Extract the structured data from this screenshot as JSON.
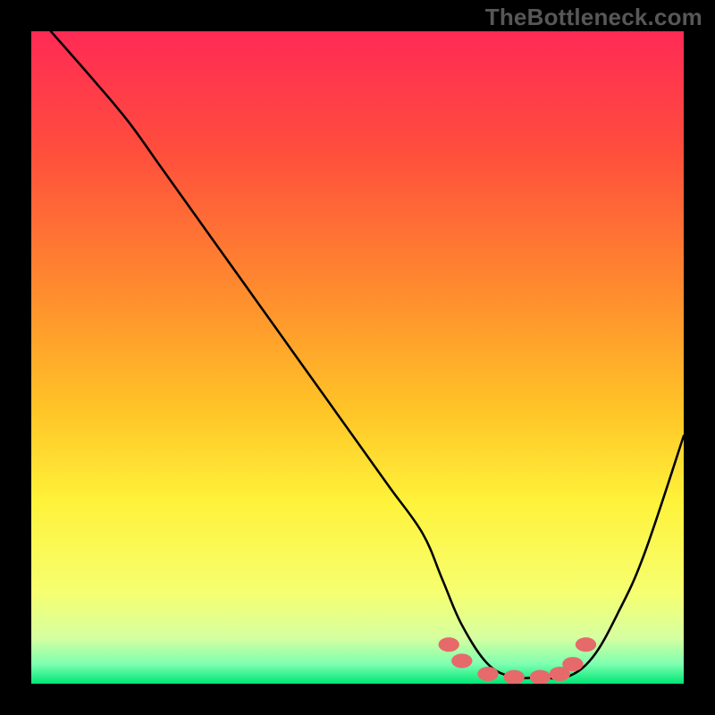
{
  "watermark": "TheBottleneck.com",
  "chart_data": {
    "type": "line",
    "title": "",
    "xlabel": "",
    "ylabel": "",
    "xlim": [
      0,
      100
    ],
    "ylim": [
      0,
      100
    ],
    "background_gradient_stops": [
      {
        "offset": 0,
        "color": "#ff2a55"
      },
      {
        "offset": 18,
        "color": "#ff4d3d"
      },
      {
        "offset": 40,
        "color": "#ff8c2e"
      },
      {
        "offset": 58,
        "color": "#ffc427"
      },
      {
        "offset": 72,
        "color": "#fff23a"
      },
      {
        "offset": 86,
        "color": "#f6ff70"
      },
      {
        "offset": 93,
        "color": "#d6ffa0"
      },
      {
        "offset": 97,
        "color": "#7dffb0"
      },
      {
        "offset": 100,
        "color": "#00e676"
      }
    ],
    "series": [
      {
        "name": "bottleneck-curve",
        "x": [
          3,
          10,
          15,
          20,
          25,
          30,
          35,
          40,
          45,
          50,
          55,
          60,
          63,
          66,
          70,
          74,
          78,
          82,
          86,
          90,
          94,
          100
        ],
        "y": [
          100,
          92,
          86,
          79,
          72,
          65,
          58,
          51,
          44,
          37,
          30,
          23,
          16,
          9,
          3,
          1,
          1,
          1,
          4,
          11,
          20,
          38
        ]
      }
    ],
    "markers": {
      "name": "highlight-band",
      "color": "#e66a6a",
      "points": [
        {
          "x": 64,
          "y": 6
        },
        {
          "x": 66,
          "y": 3.5
        },
        {
          "x": 70,
          "y": 1.5
        },
        {
          "x": 74,
          "y": 1
        },
        {
          "x": 78,
          "y": 1
        },
        {
          "x": 81,
          "y": 1.5
        },
        {
          "x": 83,
          "y": 3
        },
        {
          "x": 85,
          "y": 6
        }
      ]
    }
  }
}
